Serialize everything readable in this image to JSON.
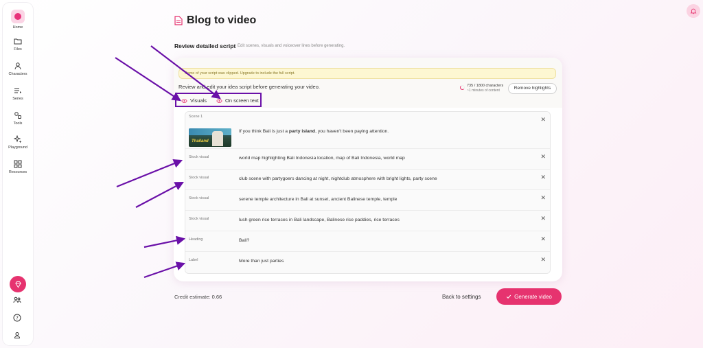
{
  "sidebar": {
    "items": [
      {
        "label": "Home",
        "icon": "home-icon"
      },
      {
        "label": "Files",
        "icon": "folder-icon"
      },
      {
        "label": "Characters",
        "icon": "person-icon"
      },
      {
        "label": "Series",
        "icon": "series-icon"
      },
      {
        "label": "Tools",
        "icon": "tools-icon"
      },
      {
        "label": "Playground",
        "icon": "sparkle-icon"
      },
      {
        "label": "Resources",
        "icon": "grid-icon"
      }
    ],
    "bottom_icons": [
      "gem-icon",
      "team-icon",
      "help-icon",
      "account-icon"
    ]
  },
  "header": {
    "title": "Blog to video",
    "section_title": "Review detailed script",
    "section_subtitle": "Edit scenes, visuals and voiceover lines before generating."
  },
  "card": {
    "warning": "Some of your script was clipped. Upgrade to include the full script.",
    "review_text": "Review and edit your idea script before generating your video.",
    "char_count": "735 / 1800 characters",
    "content_length": "~1 minutes of content",
    "remove_button": "Remove highlights",
    "toggles": {
      "visuals": "Visuals",
      "on_screen_text": "On screen text"
    }
  },
  "scene": {
    "label": "Scene 1",
    "thumbnail_text": "Thailand",
    "text_before": "If you think Bali is just a ",
    "text_bold": "party island",
    "text_after": ", you haven't been paying attention."
  },
  "rows": [
    {
      "type": "Stock visual",
      "text": "world map highlighting Bali Indonesia location, map of Bali Indonesia, world map"
    },
    {
      "type": "Stock visual",
      "text": "club scene with partygoers dancing at night, nightclub atmosphere with bright lights, party scene"
    },
    {
      "type": "Stock visual",
      "text": "serene temple architecture in Bali at sunset, ancient Balinese temple, temple"
    },
    {
      "type": "Stock visual",
      "text": "lush green rice terraces in Bali landscape, Balinese rice paddies, rice terraces"
    },
    {
      "type": "Heading",
      "text": "Bali?"
    },
    {
      "type": "Label",
      "text": "More than just parties"
    }
  ],
  "footer": {
    "credit": "Credit estimate: 0.66",
    "back": "Back to settings",
    "generate": "Generate video"
  },
  "colors": {
    "accent": "#e6336f",
    "annotation": "#6a10a8",
    "warning_bg": "#fdf7d2"
  }
}
